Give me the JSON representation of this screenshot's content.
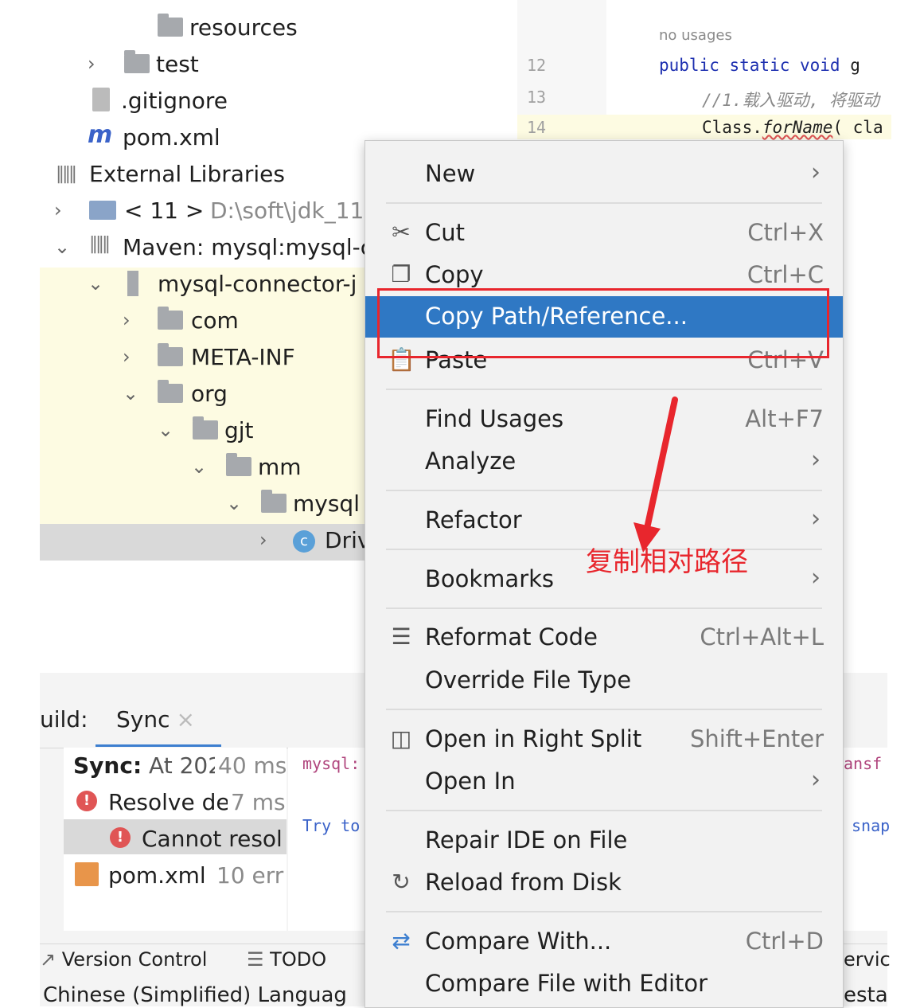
{
  "tree": {
    "rows": [
      {
        "label": "resources",
        "icon": "resources-folder-icon"
      },
      {
        "label": "test",
        "icon": "folder-icon"
      },
      {
        "label": ".gitignore",
        "icon": "gitignore-file-icon"
      },
      {
        "label": "pom.xml",
        "icon": "maven-icon"
      },
      {
        "label": "External Libraries",
        "icon": "libraries-icon"
      },
      {
        "label": "< 11 >",
        "extra": "D:\\soft\\jdk_11",
        "icon": "jdk-icon"
      },
      {
        "label": "Maven: mysql:mysql-c",
        "icon": "maven-library-icon"
      },
      {
        "label": "mysql-connector-j",
        "icon": "jar-icon"
      },
      {
        "label": "com",
        "icon": "folder-icon"
      },
      {
        "label": "META-INF",
        "icon": "folder-icon"
      },
      {
        "label": "org",
        "icon": "folder-icon"
      },
      {
        "label": "gjt",
        "icon": "folder-icon"
      },
      {
        "label": "mm",
        "icon": "folder-icon"
      },
      {
        "label": "mysql",
        "icon": "folder-icon"
      },
      {
        "label": "Driv",
        "icon": "class-icon"
      }
    ]
  },
  "editor": {
    "hint": "no usages",
    "lines": [
      {
        "num": "12",
        "code_kw": "public static  void",
        "code_rest": " g"
      },
      {
        "num": "13",
        "code_comment": "//1.载入驱动, 将驱动"
      },
      {
        "num": "14",
        "code_rest": "Class.",
        "code_method": "forName",
        "code_tail": "( cla"
      }
    ]
  },
  "build": {
    "label": "uild:",
    "tab_sync": "Sync",
    "items": [
      {
        "bold": "Sync:",
        "text": " At 202",
        "time": "40 ms"
      },
      {
        "text": "Resolve de",
        "time": "7 ms"
      },
      {
        "text": "Cannot resol"
      },
      {
        "text": "pom.xml",
        "time": "10 err"
      }
    ],
    "console_line1": "mysql:",
    "console_line2": "Try to",
    "right_line1": "ansf",
    "right_line2": "snap",
    "bottom_vc": "Version Control",
    "bottom_todo": "TODO",
    "bottom_right": "ervic",
    "status_left": "Chinese (Simplified) Languag",
    "status_right": "esta"
  },
  "menu": {
    "items": [
      {
        "label": "New",
        "shortcut": "",
        "submenu": true,
        "icon": ""
      },
      {
        "label": "Cut",
        "shortcut": "Ctrl+X",
        "submenu": false,
        "icon": "scissors-icon"
      },
      {
        "label": "Copy",
        "shortcut": "Ctrl+C",
        "submenu": false,
        "icon": "copy-icon"
      },
      {
        "label": "Copy Path/Reference...",
        "shortcut": "",
        "submenu": false,
        "icon": "",
        "selected": true
      },
      {
        "label": "Paste",
        "shortcut": "Ctrl+V",
        "submenu": false,
        "icon": "clipboard-icon"
      },
      {
        "label": "Find Usages",
        "shortcut": "Alt+F7",
        "submenu": false,
        "icon": ""
      },
      {
        "label": "Analyze",
        "shortcut": "",
        "submenu": true,
        "icon": ""
      },
      {
        "label": "Refactor",
        "shortcut": "",
        "submenu": true,
        "icon": ""
      },
      {
        "label": "Bookmarks",
        "shortcut": "",
        "submenu": true,
        "icon": ""
      },
      {
        "label": "Reformat Code",
        "shortcut": "Ctrl+Alt+L",
        "submenu": false,
        "icon": "reformat-icon"
      },
      {
        "label": "Override File Type",
        "shortcut": "",
        "submenu": false,
        "icon": ""
      },
      {
        "label": "Open in Right Split",
        "shortcut": "Shift+Enter",
        "submenu": false,
        "icon": "split-icon"
      },
      {
        "label": "Open In",
        "shortcut": "",
        "submenu": true,
        "icon": ""
      },
      {
        "label": "Repair IDE on File",
        "shortcut": "",
        "submenu": false,
        "icon": ""
      },
      {
        "label": "Reload from Disk",
        "shortcut": "",
        "submenu": false,
        "icon": "reload-icon"
      },
      {
        "label": "Compare With...",
        "shortcut": "Ctrl+D",
        "submenu": false,
        "icon": "compare-icon"
      },
      {
        "label": "Compare File with Editor",
        "shortcut": "",
        "submenu": false,
        "icon": ""
      }
    ]
  },
  "annotation": {
    "text": "复制相对路径",
    "color": "#e8262d"
  },
  "colors": {
    "selection": "#2f78c4",
    "menu_bg": "#f2f2f2",
    "library_highlight": "#fdfbe2"
  }
}
